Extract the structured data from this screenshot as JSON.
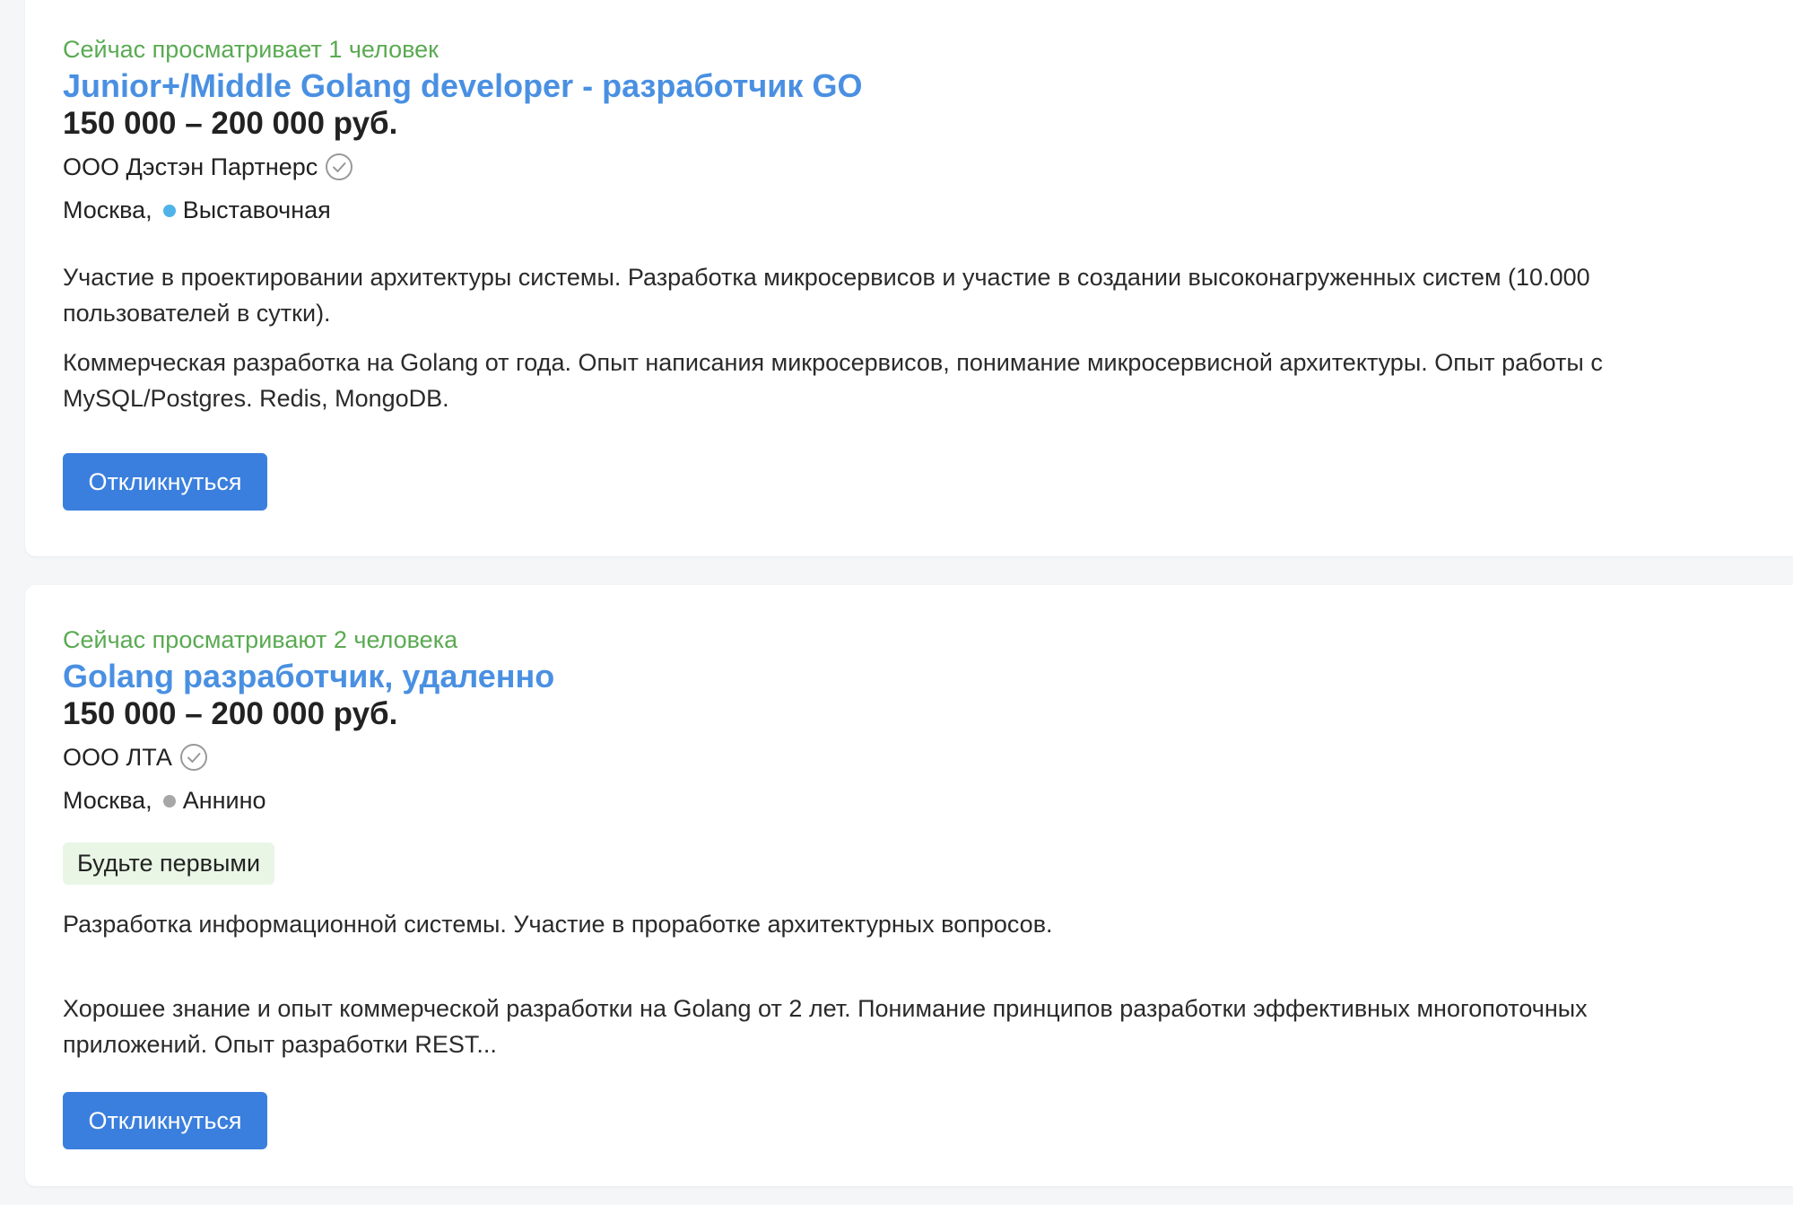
{
  "vacancies": [
    {
      "viewers": "Сейчас просматривает 1 человек",
      "title": "Junior+/Middle Golang developer - разработчик GO",
      "salary": "150 000 – 200 000 руб.",
      "company": "ООО Дэстэн Партнерс",
      "city": "Москва,",
      "metro": "Выставочная",
      "metro_color": "#4fb3ea",
      "badge": "",
      "responsibility": "Участие в проектировании архитектуры системы. Разработка микросервисов и участие в создании высоконагруженных систем (10.000 пользователей в сутки).",
      "requirement": "Коммерческая разработка на Golang от года. Опыт написания микросервисов, понимание микросервисной архитектуры. Опыт работы с MySQL/Postgres. Redis, MongoDB.",
      "respond_label": "Откликнуться"
    },
    {
      "viewers": "Сейчас просматривают 2 человека",
      "title": "Golang разработчик, удаленно",
      "salary": "150 000 – 200 000 руб.",
      "company": "ООО ЛТА",
      "city": "Москва,",
      "metro": "Аннино",
      "metro_color": "#a7a7a7",
      "badge": "Будьте первыми",
      "responsibility": "Разработка информационной системы. Участие в проработке архитектурных вопросов.",
      "requirement": "Хорошее знание и опыт коммерческой разработки на Golang от 2 лет. Понимание принципов разработки эффективных многопоточных приложений. Опыт разработки REST...",
      "respond_label": "Откликнуться"
    }
  ],
  "icons": {
    "verified": "check-circle-icon"
  },
  "colors": {
    "link": "#4a90e2",
    "viewers": "#5aaa52",
    "button": "#3a7fde",
    "badge_bg": "#e9f6e6"
  }
}
